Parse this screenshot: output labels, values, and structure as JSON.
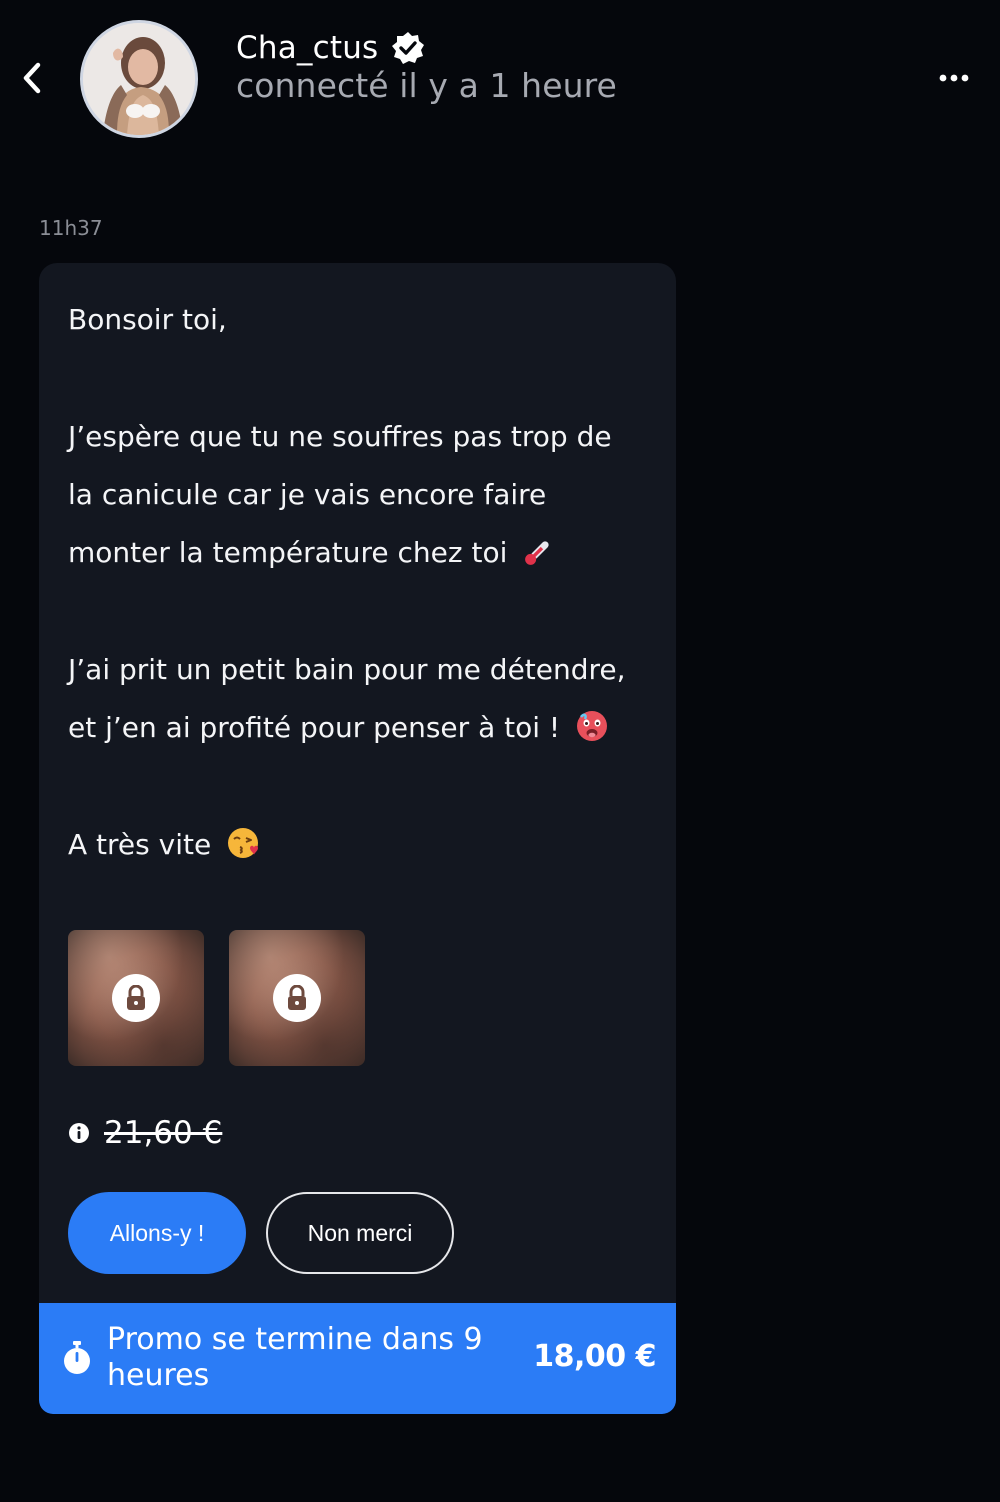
{
  "header": {
    "back_icon": "chevron-left-icon",
    "avatar_alt": "profile photo",
    "username": "Cha_ctus",
    "verified_icon": "verified-badge-icon",
    "status": "connecté il y a 1 heure",
    "more_icon": "more-horizontal-icon"
  },
  "message": {
    "timestamp": "11h37",
    "lines": [
      "Bonsoir toi,",
      "J’espère que tu ne souffres pas trop de",
      "la canicule car je vais encore faire",
      "monter la température chez toi",
      "J’ai prit un petit bain pour me détendre,",
      "et j’en ai profité pour penser à toi !",
      "A très vite"
    ],
    "emojis": [
      "thermometer",
      "hot-face",
      "kissing-heart"
    ],
    "media": [
      {
        "type": "locked",
        "icon": "lock-icon"
      },
      {
        "type": "locked",
        "icon": "lock-icon"
      }
    ],
    "info_icon": "info-icon",
    "old_price": "21,60 €",
    "accept_label": "Allons-y !",
    "decline_label": "Non merci"
  },
  "promo": {
    "icon": "stopwatch-icon",
    "text": "Promo se termine dans 9 heures",
    "price": "18,00 €"
  },
  "colors": {
    "background": "#05070c",
    "card": "#131720",
    "accent": "#2b7cf6",
    "muted_text": "#a7aab2"
  }
}
